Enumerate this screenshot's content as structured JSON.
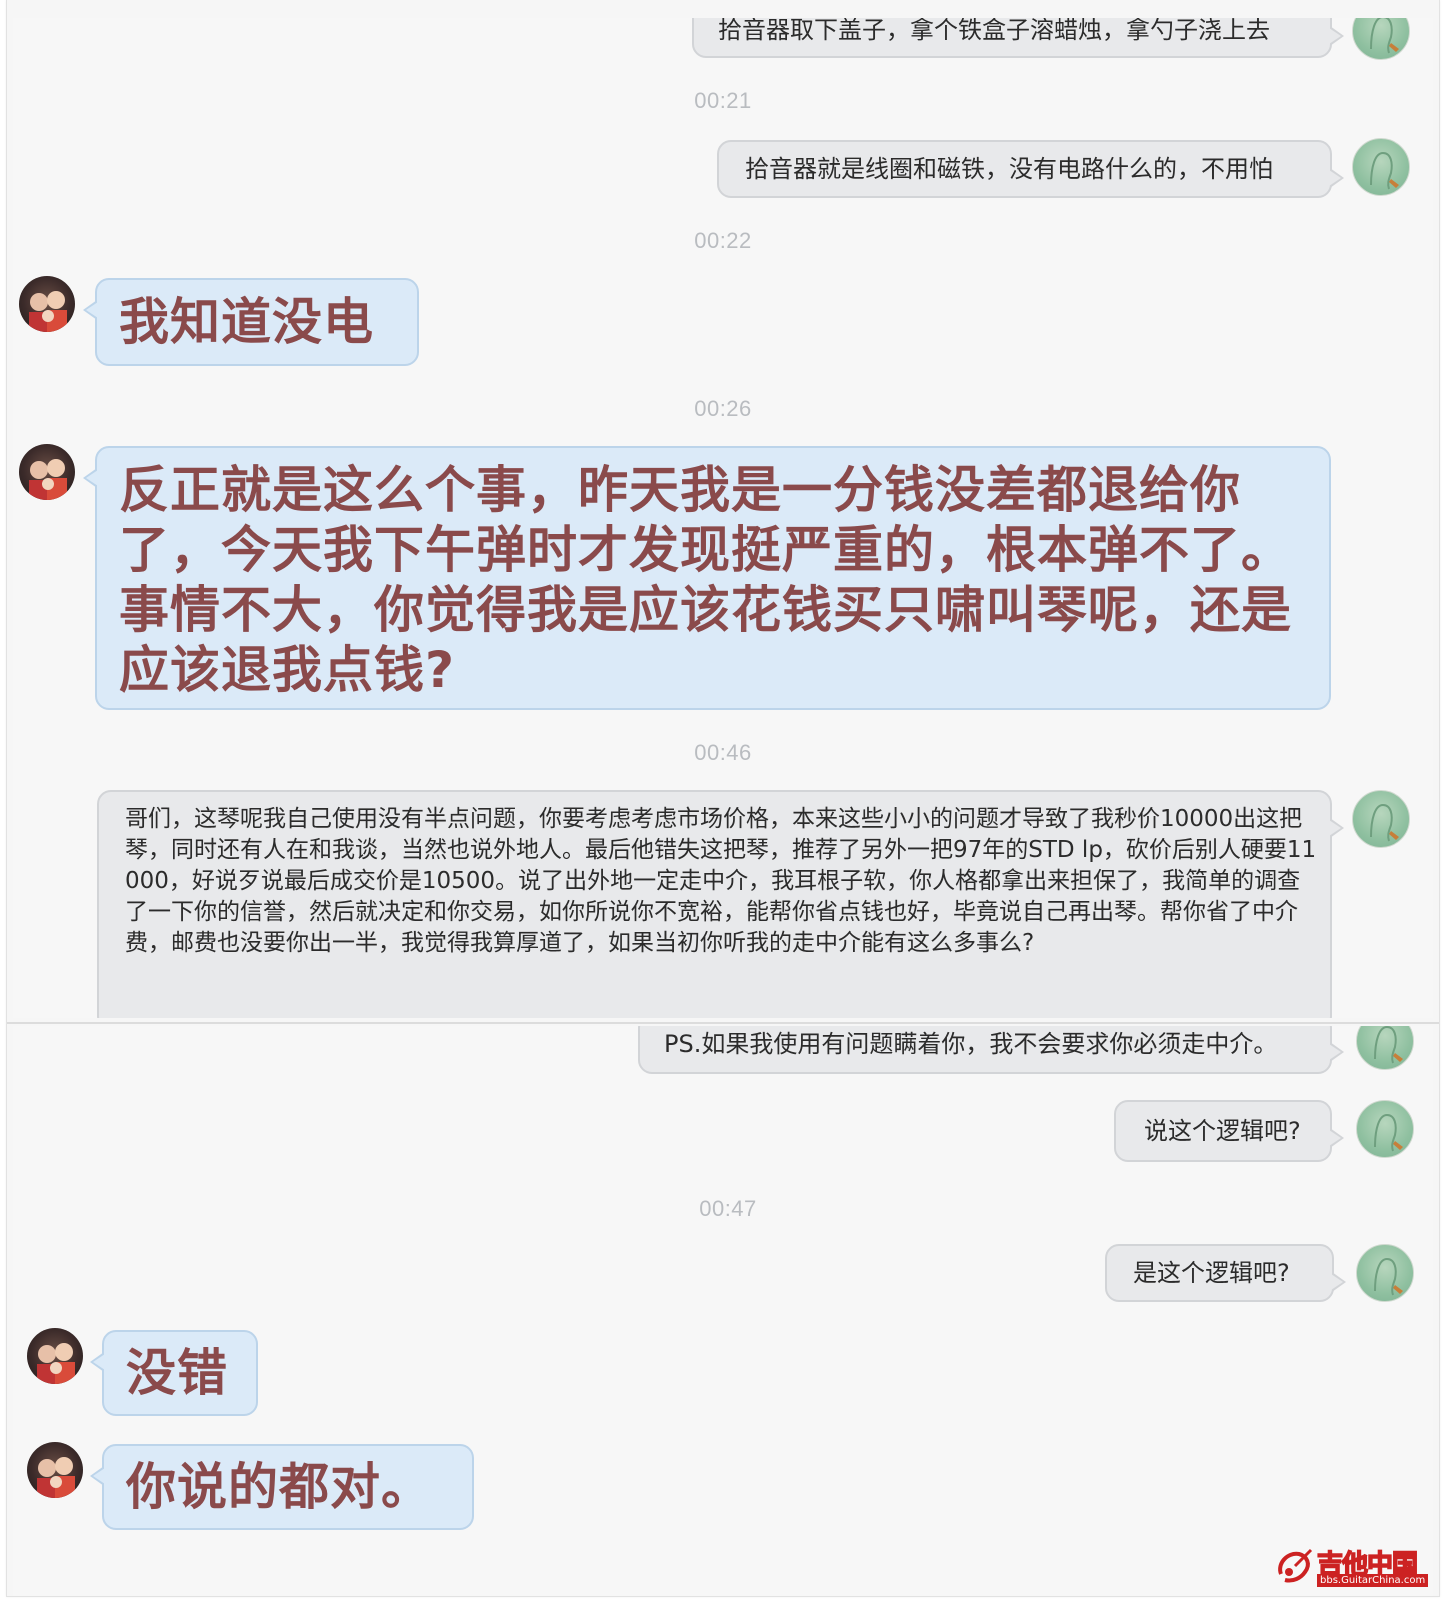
{
  "messages": {
    "m1": "拾音器取下盖子，拿个铁盒子溶蜡烛，拿勺子浇上去",
    "ts1": "00:21",
    "m2": "拾音器就是线圈和磁铁，没有电路什么的，不用怕",
    "ts2": "00:22",
    "m3": "我知道没电",
    "ts3": "00:26",
    "m4": "反正就是这么个事，昨天我是一分钱没差都退给你了，今天我下午弹时才发现挺严重的，根本弹不了。事情不大，你觉得我是应该花钱买只啸叫琴呢，还是应该退我点钱?",
    "ts4": "00:46",
    "m5": "哥们，这琴呢我自己使用没有半点问题，你要考虑考虑市场价格，本来这些小小的问题才导致了我秒价10000出这把琴，同时还有人在和我谈，当然也说外地人。最后他错失这把琴，推荐了另外一把97年的STD lp，砍价后别人硬要11000，好说歹说最后成交价是10500。说了出外地一定走中介，我耳根子软，你人格都拿出来担保了，我简单的调查了一下你的信誉，然后就决定和你交易，如你所说你不宽裕，能帮你省点钱也好，毕竟说自己再出琴。帮你省了中介费，邮费也没要你出一半，我觉得我算厚道了，如果当初你听我的走中介能有这么多事么?",
    "m6": "PS.如果我使用有问题瞒着你，我不会要求你必须走中介。",
    "m7": "说这个逻辑吧?",
    "ts5": "00:47",
    "m8": "是这个逻辑吧?",
    "m9": "没错",
    "m10": "你说的都对。"
  },
  "watermark": {
    "title": "吉他中国",
    "sub": "bbs.GuitarChina.com"
  },
  "colors": {
    "outgoing_bubble": "#e8e9eb",
    "incoming_bubble": "#dbeaf8",
    "incoming_text": "#8a4a4b",
    "timestamp": "#b9bcc0",
    "logo_red": "#cc2222"
  },
  "icons": {
    "self_avatar": "user-silhouette-icon",
    "other_avatar": "photo-avatar",
    "logo": "guitar-logo-icon"
  }
}
